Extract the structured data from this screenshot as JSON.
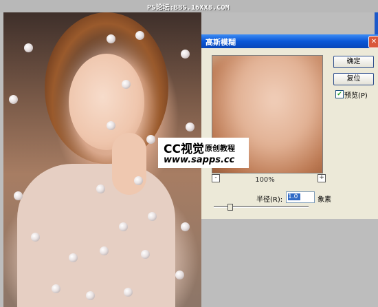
{
  "header": {
    "site_text": "PS论坛:BBS.16XX8.COM"
  },
  "dialog": {
    "title": "高斯模糊",
    "close_glyph": "✕",
    "ok_label": "确定",
    "reset_label": "复位",
    "preview_label": "预览(P)",
    "preview_checked": true,
    "zoom": "100%",
    "zoom_out": "-",
    "zoom_in": "+",
    "radius_label": "半径(R):",
    "radius_value": "1.0",
    "radius_unit": "象素"
  },
  "watermark": {
    "brand": "CC视觉",
    "tagline": "原创教程",
    "url": "www.sapps.cc"
  },
  "colors": {
    "titlebar": "#0a56d6",
    "dialog_bg": "#ece9d8",
    "desktop": "#bdbdbd"
  }
}
